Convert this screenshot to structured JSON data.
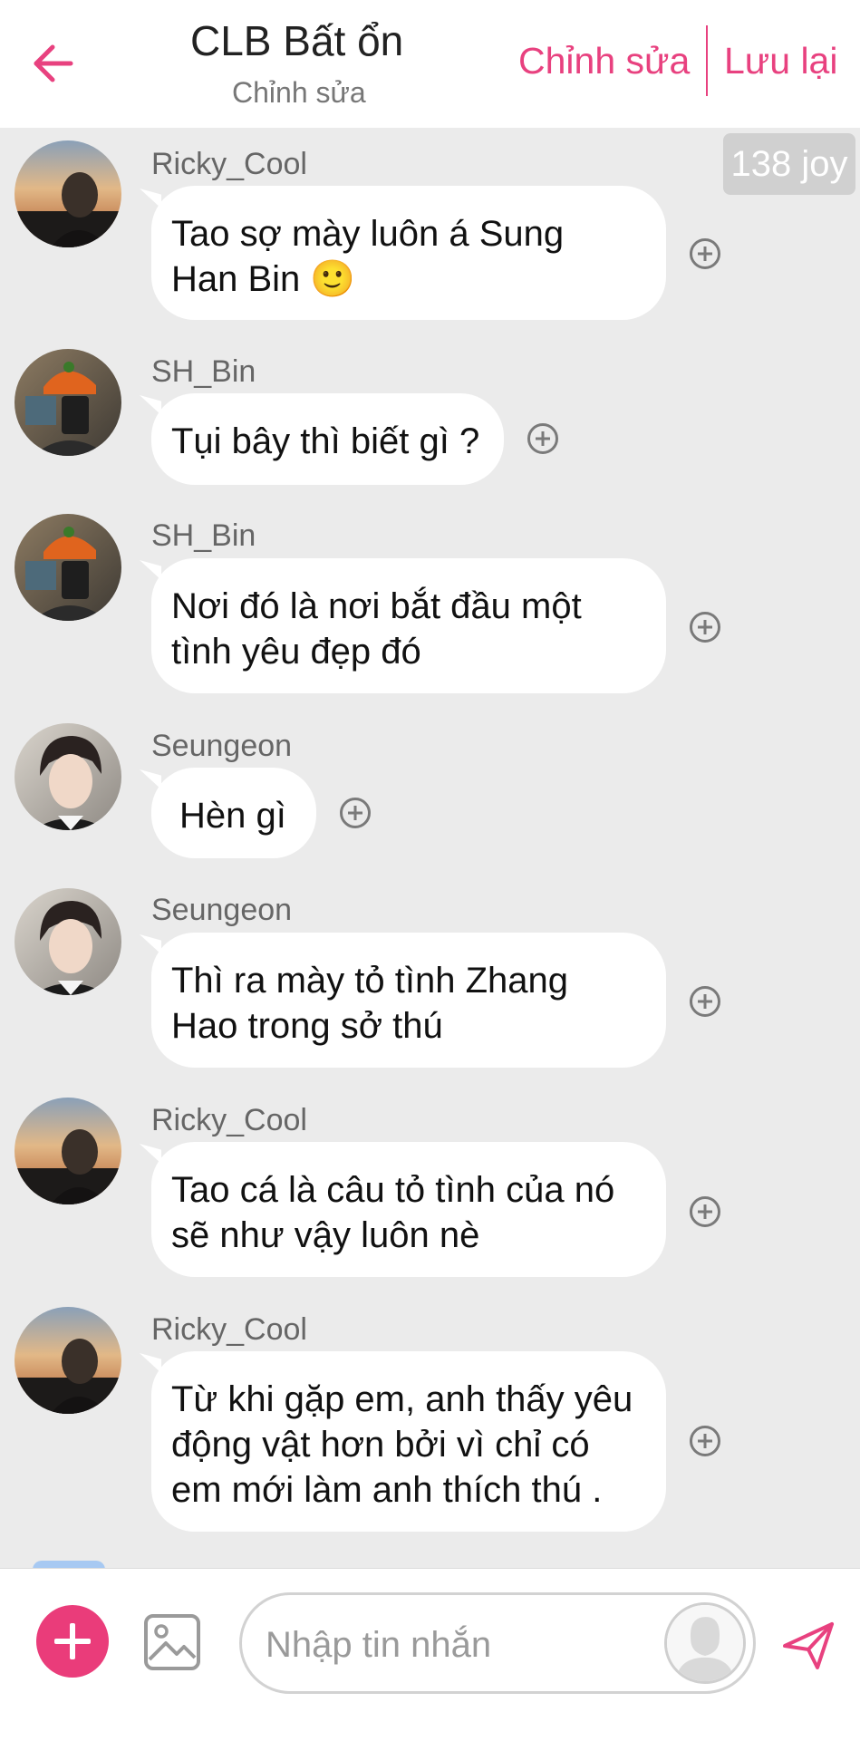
{
  "header": {
    "title": "CLB Bất ổn",
    "subtitle": "Chỉnh sửa",
    "edit_label": "Chỉnh sửa",
    "save_label": "Lưu lại",
    "accent_color": "#e8417f"
  },
  "joy_badge": "138 joy",
  "messages": [
    {
      "sender": "Ricky_Cool",
      "avatar": "sunset-portrait",
      "lines": [
        "Tao sợ mày luôn á Sung",
        "Han Bin 🙂"
      ]
    },
    {
      "sender": "SH_Bin",
      "avatar": "orange-hat-selfie",
      "lines": [
        "Tụi bây thì biết gì ?"
      ]
    },
    {
      "sender": "SH_Bin",
      "avatar": "orange-hat-selfie",
      "lines": [
        "Nơi đó là nơi bắt đầu một",
        "tình yêu đẹp đó"
      ]
    },
    {
      "sender": "Seungeon",
      "avatar": "portrait",
      "lines": [
        "Hèn gì"
      ]
    },
    {
      "sender": "Seungeon",
      "avatar": "portrait",
      "lines": [
        "Thì ra mày tỏ tình Zhang",
        "Hao trong sở thú"
      ]
    },
    {
      "sender": "Ricky_Cool",
      "avatar": "sunset-portrait",
      "lines": [
        "Tao cá là câu tỏ tình của nó",
        "sẽ như vậy luôn nè"
      ]
    },
    {
      "sender": "Ricky_Cool",
      "avatar": "sunset-portrait",
      "lines": [
        "Từ khi gặp em, anh thấy yêu",
        "động vật hơn bởi vì chỉ có",
        "em mới làm anh thích thú ."
      ]
    }
  ],
  "composer": {
    "placeholder": "Nhập tin nhắn",
    "value": ""
  },
  "icons": {
    "back": "arrow-left-icon",
    "react": "plus-circle-icon",
    "add": "plus-icon",
    "image": "image-icon",
    "send": "send-icon"
  }
}
